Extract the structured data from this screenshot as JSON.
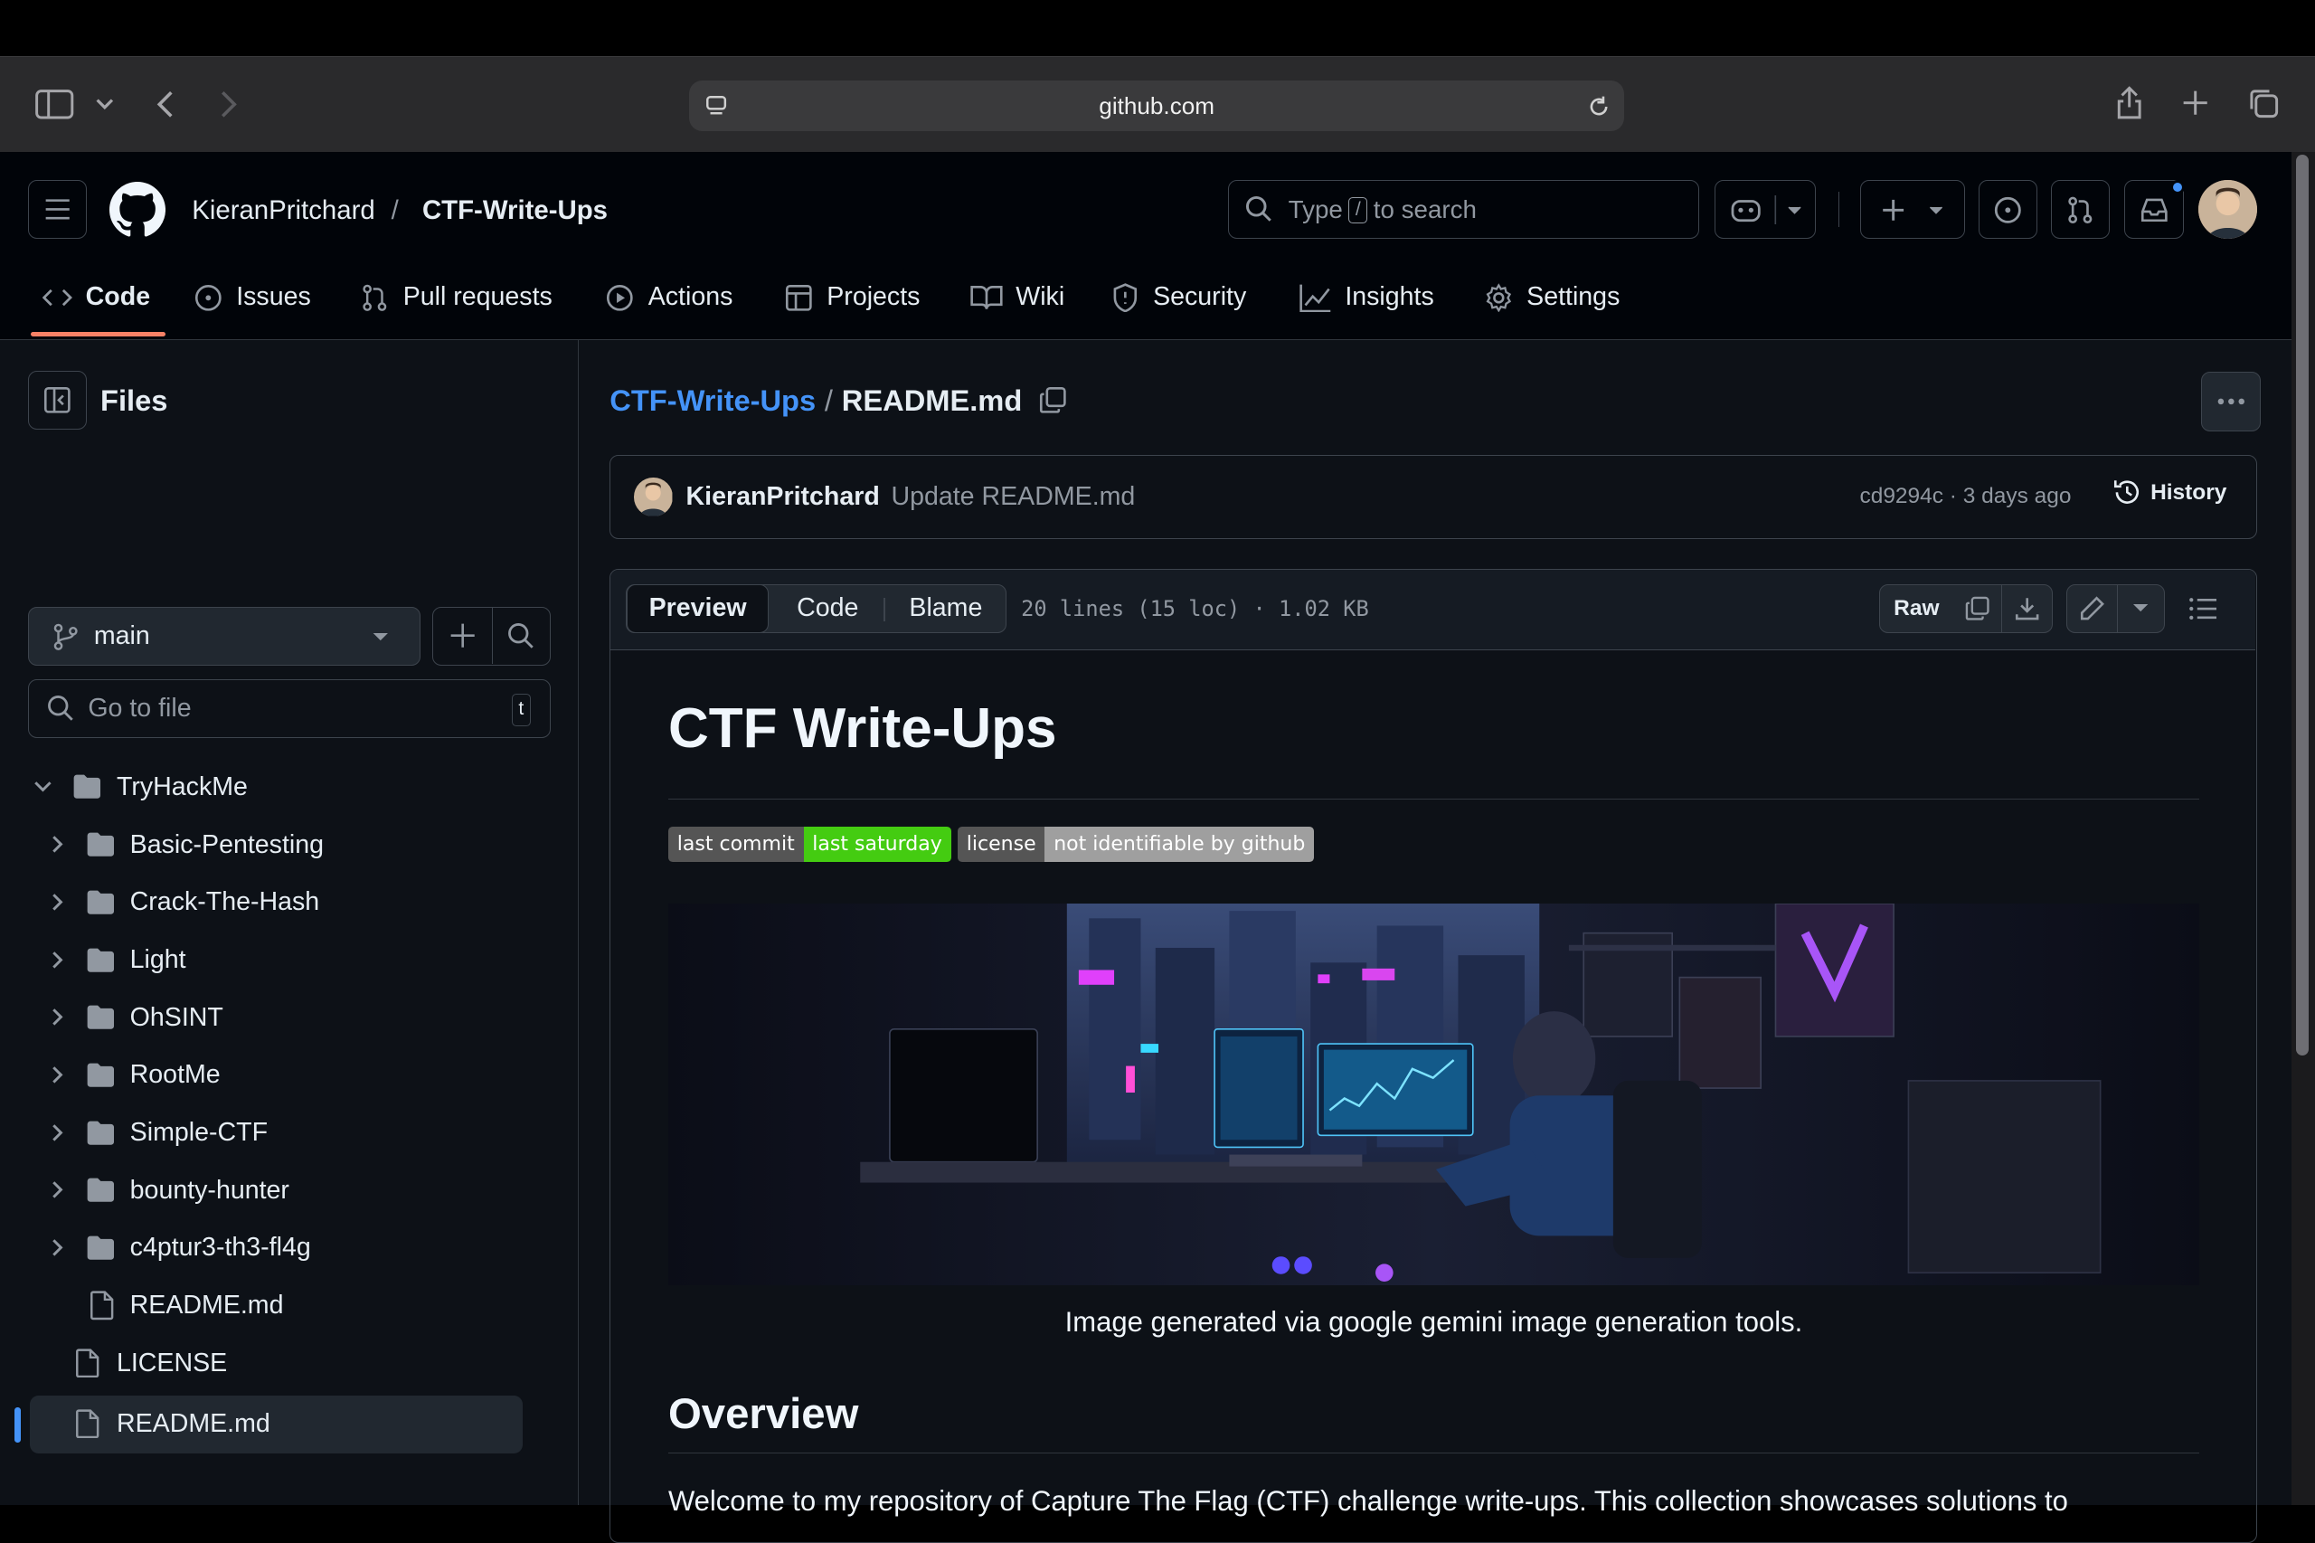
{
  "browser": {
    "url": "github.com"
  },
  "repo": {
    "owner": "KieranPritchard",
    "separator": "/",
    "name": "CTF-Write-Ups"
  },
  "search": {
    "pre": "Type",
    "key": "/",
    "post": "to search"
  },
  "nav": {
    "code": "Code",
    "issues": "Issues",
    "pulls": "Pull requests",
    "actions": "Actions",
    "projects": "Projects",
    "wiki": "Wiki",
    "security": "Security",
    "insights": "Insights",
    "settings": "Settings"
  },
  "sidebar": {
    "title": "Files",
    "branch": "main",
    "goto_placeholder": "Go to file",
    "goto_key": "t",
    "tree": [
      {
        "label": "TryHackMe"
      },
      {
        "label": "Basic-Pentesting"
      },
      {
        "label": "Crack-The-Hash"
      },
      {
        "label": "Light"
      },
      {
        "label": "OhSINT"
      },
      {
        "label": "RootMe"
      },
      {
        "label": "Simple-CTF"
      },
      {
        "label": "bounty-hunter"
      },
      {
        "label": "c4ptur3-th3-fl4g"
      },
      {
        "label": "README.md"
      },
      {
        "label": "LICENSE"
      },
      {
        "label": "README.md"
      }
    ]
  },
  "file": {
    "repo_link": "CTF-Write-Ups",
    "sep": "/",
    "name": "README.md",
    "commit_author": "KieranPritchard",
    "commit_message": "Update README.md",
    "commit_meta": "cd9294c · 3 days ago",
    "history": "History",
    "tab_preview": "Preview",
    "tab_code": "Code",
    "tab_blame": "Blame",
    "stats": "20 lines (15 loc) · 1.02 KB",
    "raw": "Raw"
  },
  "readme": {
    "title": "CTF Write-Ups",
    "badge1_label": "last commit",
    "badge1_value": "last saturday",
    "badge2_label": "license",
    "badge2_value": "not identifiable by github",
    "caption": "Image generated via google gemini image generation tools.",
    "overview": "Overview",
    "paragraph": "Welcome to my repository of Capture The Flag (CTF) challenge write-ups. This collection showcases solutions to"
  },
  "colors": {
    "accent": "#4493f8",
    "underline": "#f78166",
    "badge_green": "#4c1",
    "badge_gray": "#555",
    "badge_lgray": "#9f9f9f"
  },
  "icons": [
    "sidebar-icon",
    "back-icon",
    "forward-icon",
    "share-icon",
    "new-tab-icon",
    "tabs-icon",
    "github-logo",
    "copilot-icon",
    "plus-icon",
    "issue-icon",
    "pull-request-icon",
    "inbox-icon",
    "copy-icon",
    "history-icon",
    "download-icon",
    "pencil-icon",
    "list-icon",
    "folder-icon",
    "file-icon",
    "chevron-icon"
  ]
}
